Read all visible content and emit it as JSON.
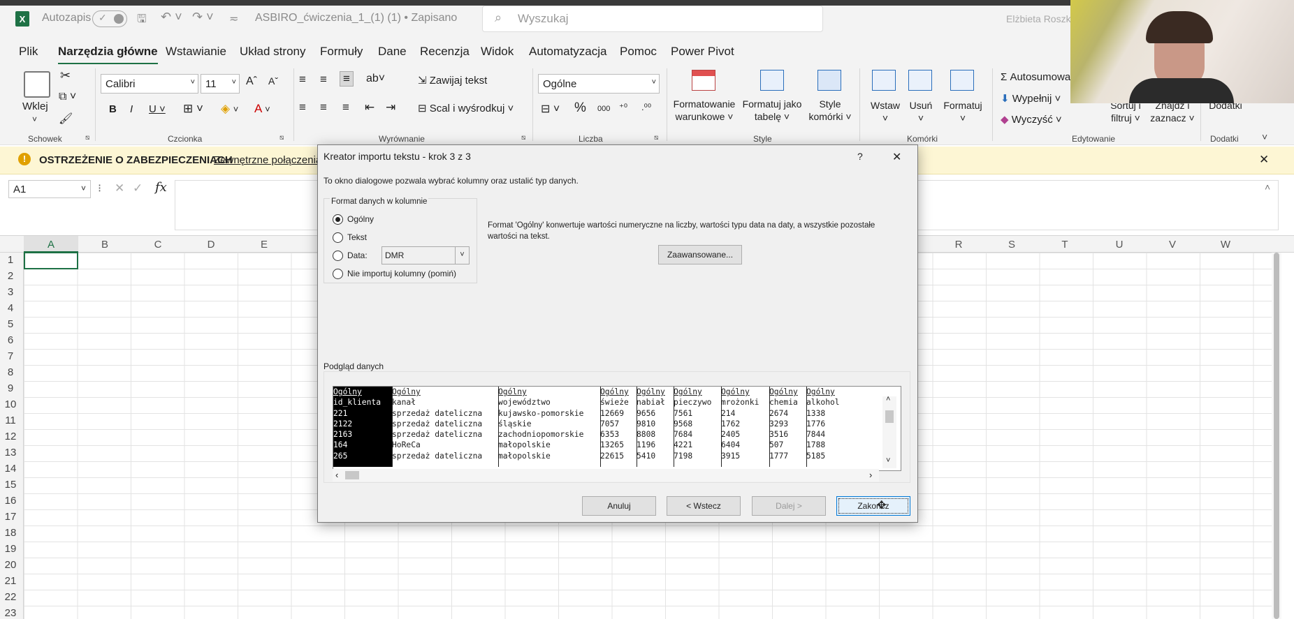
{
  "titlebar": {
    "autosave_label": "Autozapis",
    "doc_title": "ASBIRO_ćwiczenia_1_(1) (1) • Zapisano",
    "search_placeholder": "Wyszukaj",
    "user": "Elżbieta Roszk"
  },
  "menu": {
    "tabs": [
      "Plik",
      "Narzędzia główne",
      "Wstawianie",
      "Układ strony",
      "Formuły",
      "Dane",
      "Recenzja",
      "Widok",
      "Automatyzacja",
      "Pomoc",
      "Power Pivot"
    ],
    "active": "Narzędzia główne"
  },
  "ribbon": {
    "paste_label": "Wklej",
    "font_name": "Calibri",
    "font_size": "11",
    "wrap_text": "Zawijaj tekst",
    "merge_center": "Scal i wyśrodkuj",
    "number_format": "Ogólne",
    "cond_format": [
      "Formatowanie",
      "warunkowe"
    ],
    "format_table": [
      "Formatuj jako",
      "tabelę"
    ],
    "cell_styles": [
      "Style",
      "komórki"
    ],
    "insert": "Wstaw",
    "delete": "Usuń",
    "format": "Formatuj",
    "autosum": "Autosumowa",
    "fill": "Wypełnij",
    "clear": "Wyczyść",
    "sort_filter": [
      "Sortuj i",
      "filtruj"
    ],
    "find_select": [
      "Znajdź i",
      "zaznacz"
    ],
    "addins": "Dodatki",
    "group_labels": {
      "clipboard": "Schowek",
      "font": "Czcionka",
      "alignment": "Wyrównanie",
      "number": "Liczba",
      "styles": "Style",
      "cells": "Komórki",
      "editing": "Edytowanie",
      "addins": "Dodatki"
    },
    "num_percent": "%",
    "num_thousands": "000"
  },
  "warning": {
    "title": "OSTRZEŻENIE O ZABEZPIECZENIACH",
    "link": "Zewnętrzne połączenia"
  },
  "formula_bar": {
    "name_box": "A1",
    "fx": "fx"
  },
  "sheet": {
    "columns": [
      "A",
      "B",
      "C",
      "D",
      "E",
      "R",
      "S",
      "T",
      "U",
      "V",
      "W"
    ],
    "rows": [
      "1",
      "2",
      "3",
      "4",
      "5",
      "6",
      "7",
      "8",
      "9",
      "10",
      "11",
      "12",
      "13",
      "14",
      "15",
      "16",
      "17",
      "18",
      "19",
      "20",
      "21",
      "22",
      "23"
    ]
  },
  "dialog": {
    "title": "Kreator importu tekstu - krok 3 z 3",
    "help": "?",
    "close": "✕",
    "intro": "To okno dialogowe pozwala wybrać kolumny oraz ustalić typ danych.",
    "group_title": "Format danych w kolumnie",
    "options": [
      "Ogólny",
      "Tekst",
      "Data:",
      "Nie importuj kolumny (pomiń)"
    ],
    "selected_option": "Ogólny",
    "date_format": "DMR",
    "description_line1": "Format 'Ogólny' konwertuje wartości numeryczne na liczby, wartości typu data na daty, a wszystkie pozostałe",
    "description_line2": "wartości na tekst.",
    "advanced_button": "Zaawansowane...",
    "preview_label": "Podgląd danych",
    "preview_columns": [
      {
        "header": "Ogólny",
        "lines": [
          "id_klienta",
          "221",
          "2122",
          "2163",
          "164",
          "265"
        ]
      },
      {
        "header": "Ogólny",
        "lines": [
          "kanał",
          "sprzedaż dateliczna",
          "sprzedaż dateliczna",
          "sprzedaż dateliczna",
          "HoReCa",
          "sprzedaż dateliczna"
        ]
      },
      {
        "header": "Ogólny",
        "lines": [
          "województwo",
          "kujawsko-pomorskie",
          "śląskie",
          "zachodniopomorskie",
          "małopolskie",
          "małopolskie"
        ]
      },
      {
        "header": "Ogólny",
        "lines": [
          "świeże",
          "12669",
          "7057",
          "6353",
          "13265",
          "22615"
        ]
      },
      {
        "header": "Ogólny",
        "lines": [
          "nabiał",
          "9656",
          "9810",
          "8808",
          "1196",
          "5410"
        ]
      },
      {
        "header": "Ogólny",
        "lines": [
          "pieczywo",
          "7561",
          "9568",
          "7684",
          "4221",
          "7198"
        ]
      },
      {
        "header": "Ogólny",
        "lines": [
          "mrożonki",
          "214",
          "1762",
          "2405",
          "6404",
          "3915"
        ]
      },
      {
        "header": "Ogólny",
        "lines": [
          "chemia",
          "2674",
          "3293",
          "3516",
          "507",
          "1777"
        ]
      },
      {
        "header": "Ogólny",
        "lines": [
          "alkohol",
          "1338",
          "1776",
          "7844",
          "1788",
          "5185"
        ]
      }
    ],
    "buttons": {
      "cancel": "Anuluj",
      "back": "< Wstecz",
      "next": "Dalej >",
      "finish": "Zakończ"
    }
  },
  "colors": {
    "excel_green": "#1e7145",
    "warning_bg": "#fdf6d4",
    "dialog_bg": "#f0f0f0"
  }
}
